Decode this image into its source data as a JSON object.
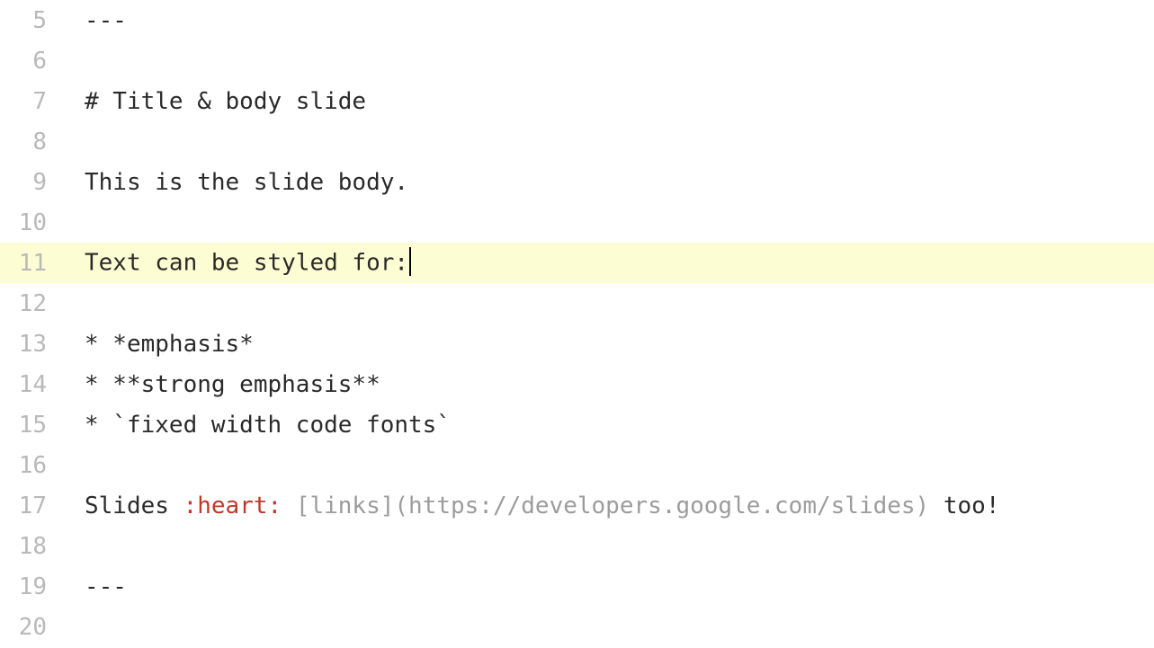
{
  "editor": {
    "active_line_index": 6,
    "lines": [
      {
        "number": 5,
        "tokens": [
          {
            "t": "---",
            "c": "plain"
          }
        ]
      },
      {
        "number": 6,
        "tokens": []
      },
      {
        "number": 7,
        "tokens": [
          {
            "t": "# Title & body slide",
            "c": "plain"
          }
        ]
      },
      {
        "number": 8,
        "tokens": []
      },
      {
        "number": 9,
        "tokens": [
          {
            "t": "This is the slide body.",
            "c": "plain"
          }
        ]
      },
      {
        "number": 10,
        "tokens": []
      },
      {
        "number": 11,
        "tokens": [
          {
            "t": "Text can be styled for:",
            "c": "plain"
          }
        ],
        "cursor_after": true
      },
      {
        "number": 12,
        "tokens": []
      },
      {
        "number": 13,
        "tokens": [
          {
            "t": "* *emphasis*",
            "c": "plain"
          }
        ]
      },
      {
        "number": 14,
        "tokens": [
          {
            "t": "* **strong emphasis**",
            "c": "plain"
          }
        ]
      },
      {
        "number": 15,
        "tokens": [
          {
            "t": "* `fixed width code fonts`",
            "c": "plain"
          }
        ]
      },
      {
        "number": 16,
        "tokens": []
      },
      {
        "number": 17,
        "tokens": [
          {
            "t": "Slides ",
            "c": "plain"
          },
          {
            "t": ":heart:",
            "c": "emoji"
          },
          {
            "t": " ",
            "c": "plain"
          },
          {
            "t": "[links](https://developers.google.com/slides)",
            "c": "link"
          },
          {
            "t": " too!",
            "c": "plain"
          }
        ]
      },
      {
        "number": 18,
        "tokens": []
      },
      {
        "number": 19,
        "tokens": [
          {
            "t": "---",
            "c": "plain"
          }
        ]
      },
      {
        "number": 20,
        "tokens": []
      }
    ]
  }
}
